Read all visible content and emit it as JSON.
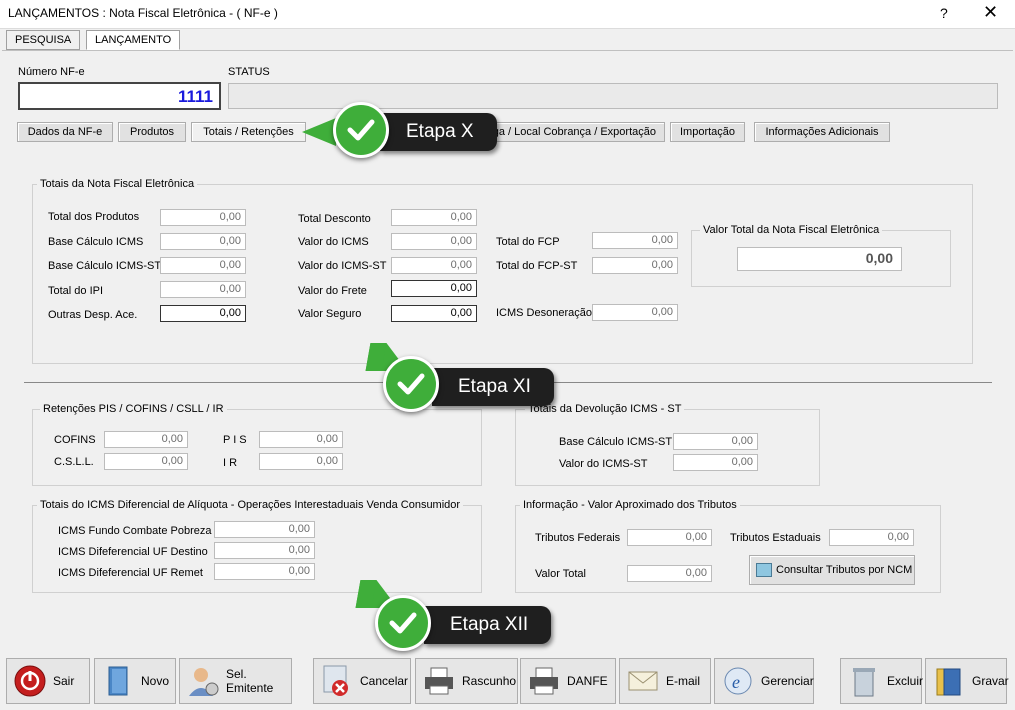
{
  "window": {
    "title": "LANÇAMENTOS : Nota Fiscal Eletrônica - ( NF-e )",
    "help": "?",
    "close": "✕"
  },
  "main_tabs": {
    "pesquisa": "PESQUISA",
    "lancamento": "LANÇAMENTO"
  },
  "header": {
    "numero_label": "Número NF-e",
    "numero_value": "1111",
    "status_label": "STATUS",
    "status_value": ""
  },
  "sub_tabs": {
    "dados": "Dados da NF-e",
    "produtos": "Produtos",
    "totais": "Totais / Retenções",
    "entrega": "ntrega / Local Cobrança / Exportação",
    "importacao": "Importação",
    "info": "Informações Adicionais"
  },
  "totais": {
    "title": "Totais da Nota Fiscal Eletrônica",
    "total_produtos": {
      "label": "Total dos Produtos",
      "value": "0,00"
    },
    "base_icms": {
      "label": "Base Cálculo ICMS",
      "value": "0,00"
    },
    "base_icms_st": {
      "label": "Base Cálculo ICMS-ST",
      "value": "0,00"
    },
    "total_ipi": {
      "label": "Total do IPI",
      "value": "0,00"
    },
    "outras_desp": {
      "label": "Outras Desp. Ace.",
      "value": "0,00"
    },
    "total_desconto": {
      "label": "Total Desconto",
      "value": "0,00"
    },
    "valor_icms": {
      "label": "Valor do ICMS",
      "value": "0,00"
    },
    "valor_icms_st": {
      "label": "Valor do ICMS-ST",
      "value": "0,00"
    },
    "valor_frete": {
      "label": "Valor do Frete",
      "value": "0,00"
    },
    "valor_seguro": {
      "label": "Valor Seguro",
      "value": "0,00"
    },
    "total_fcp": {
      "label": "Total do FCP",
      "value": "0,00"
    },
    "total_fcp_st": {
      "label": "Total do FCP-ST",
      "value": "0,00"
    },
    "icms_desoneracao": {
      "label": "ICMS Desoneração",
      "value": "0,00"
    },
    "valor_total_title": "Valor Total da Nota Fiscal Eletrônica",
    "valor_total": "0,00"
  },
  "retencoes": {
    "title": "Retenções PIS / COFINS / CSLL / IR",
    "cofins": {
      "label": "COFINS",
      "value": "0,00"
    },
    "csll": {
      "label": "C.S.L.L.",
      "value": "0,00"
    },
    "pis": {
      "label": "P I S",
      "value": "0,00"
    },
    "ir": {
      "label": "I R",
      "value": "0,00"
    }
  },
  "devolucao": {
    "title": "Totais da Devolução ICMS - ST",
    "base": {
      "label": "Base Cálculo ICMS-ST",
      "value": "0,00"
    },
    "valor": {
      "label": "Valor do ICMS-ST",
      "value": "0,00"
    }
  },
  "difal": {
    "title": "Totais do ICMS Diferencial de Alíquota - Operações  Interestaduais Venda Consumidor",
    "fcp": {
      "label": "ICMS Fundo Combate Pobreza",
      "value": "0,00"
    },
    "destino": {
      "label": "ICMS Difeferencial UF Destino",
      "value": "0,00"
    },
    "remet": {
      "label": "ICMS Difeferencial UF Remet",
      "value": "0,00"
    }
  },
  "tributos": {
    "title": "Informação - Valor Aproximado dos Tributos",
    "federais": {
      "label": "Tributos Federais",
      "value": "0,00"
    },
    "estaduais": {
      "label": "Tributos Estaduais",
      "value": "0,00"
    },
    "total": {
      "label": "Valor Total",
      "value": "0,00"
    },
    "consultar": "Consultar Tributos por NCM"
  },
  "etapas": {
    "x": "Etapa X",
    "xi": "Etapa XI",
    "xii": "Etapa XII"
  },
  "toolbar": {
    "sair": "Sair",
    "novo": "Novo",
    "emitente": "Sel. Emitente",
    "cancelar": "Cancelar",
    "rascunho": "Rascunho",
    "danfe": "DANFE",
    "email": "E-mail",
    "gerenciar": "Gerenciar",
    "excluir": "Excluir",
    "gravar": "Gravar"
  },
  "colors": {
    "accent_blue": "#1a1adc",
    "etapa_green": "#3fae3a",
    "etapa_dark": "#1f1f1f"
  }
}
